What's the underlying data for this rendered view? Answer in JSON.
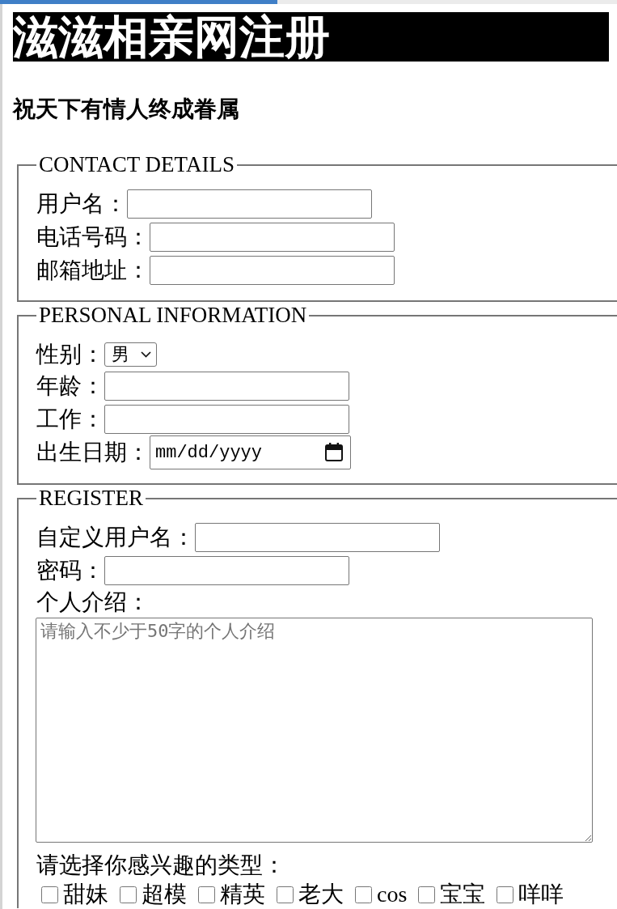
{
  "load_bar": {
    "level": 0.45
  },
  "title": "滋滋相亲网注册",
  "subtitle": "祝天下有情人终成眷属",
  "sections": [
    {
      "legend": "CONTACT DETAILS",
      "fields": [
        {
          "kind": "text",
          "label": "用户名："
        },
        {
          "kind": "text",
          "label": "电话号码："
        },
        {
          "kind": "text",
          "label": "邮箱地址："
        }
      ]
    },
    {
      "legend": "PERSONAL INFORMATION",
      "fields": [
        {
          "kind": "select",
          "label": "性别：",
          "value": "男"
        },
        {
          "kind": "text",
          "label": "年龄："
        },
        {
          "kind": "text",
          "label": "工作："
        },
        {
          "kind": "date",
          "label": "出生日期：",
          "placeholder": "mm/dd/yyyy"
        }
      ]
    },
    {
      "legend": "REGISTER",
      "fields": [
        {
          "kind": "text",
          "label": "自定义用户名："
        },
        {
          "kind": "password",
          "label": "密码："
        },
        {
          "kind": "textarea",
          "label": "个人介绍：",
          "placeholder": "请输入不少于50字的个人介绍"
        },
        {
          "kind": "checkboxes",
          "label": "请选择你感兴趣的类型：",
          "options": [
            {
              "label": "甜妹",
              "checked": false
            },
            {
              "label": "超模",
              "checked": false
            },
            {
              "label": "精英",
              "checked": false
            },
            {
              "label": "老大",
              "checked": false
            },
            {
              "label": "cos",
              "checked": false
            },
            {
              "label": "宝宝",
              "checked": false
            },
            {
              "label": "咩咩",
              "checked": false
            }
          ]
        }
      ]
    }
  ]
}
